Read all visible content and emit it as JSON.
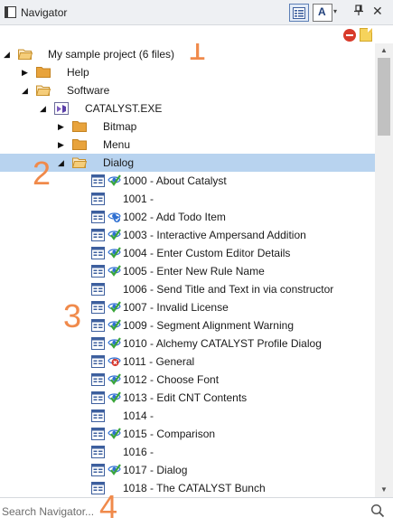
{
  "window": {
    "title": "Navigator"
  },
  "toolbar": {
    "filter_icon": "filter-icon",
    "list_view_icon": "list-view-icon",
    "font_button_label": "A",
    "font_dropdown_glyph": "▾",
    "pin_glyph": "⊥",
    "close_glyph": "✕"
  },
  "tree": {
    "project_label": "My sample project (6 files)",
    "help_label": "Help",
    "software_label": "Software",
    "exe_label": "CATALYST.EXE",
    "bitmap_label": "Bitmap",
    "menu_label": "Menu",
    "dialog_label": "Dialog",
    "items": [
      {
        "label": "1000 - About Catalyst",
        "status": "translated"
      },
      {
        "label": "1001 -",
        "status": "none"
      },
      {
        "label": "1002 - Add Todo Item",
        "status": "for-review"
      },
      {
        "label": "1003 - Interactive Ampersand Addition",
        "status": "translated"
      },
      {
        "label": "1004 - Enter Custom Editor Details",
        "status": "translated"
      },
      {
        "label": "1005 - Enter New Rule Name",
        "status": "translated"
      },
      {
        "label": "1006 - Send Title and Text in via constructor",
        "status": "none"
      },
      {
        "label": "1007 - Invalid License",
        "status": "translated"
      },
      {
        "label": "1009 - Segment Alignment Warning",
        "status": "translated"
      },
      {
        "label": "1010 - Alchemy CATALYST Profile Dialog",
        "status": "translated"
      },
      {
        "label": "1011 - General",
        "status": "rejected"
      },
      {
        "label": "1012 - Choose Font",
        "status": "translated"
      },
      {
        "label": "1013 - Edit CNT Contents",
        "status": "translated"
      },
      {
        "label": "1014 -",
        "status": "none"
      },
      {
        "label": "1015 - Comparison",
        "status": "translated"
      },
      {
        "label": "1016 -",
        "status": "none"
      },
      {
        "label": "1017 - Dialog",
        "status": "translated"
      },
      {
        "label": "1018 - The CATALYST Bunch",
        "status": "none"
      }
    ]
  },
  "callouts": {
    "c1": "1",
    "c2": "2",
    "c3": "3",
    "c4": "4"
  },
  "search": {
    "placeholder": "Search Navigator...",
    "value": ""
  },
  "colors": {
    "selection": "#b8d3ef",
    "callout": "#f08a4b",
    "folder": "#e8a33c",
    "status_green": "#3aa53a",
    "status_blue": "#2e6fd1",
    "status_red": "#d8352a"
  }
}
